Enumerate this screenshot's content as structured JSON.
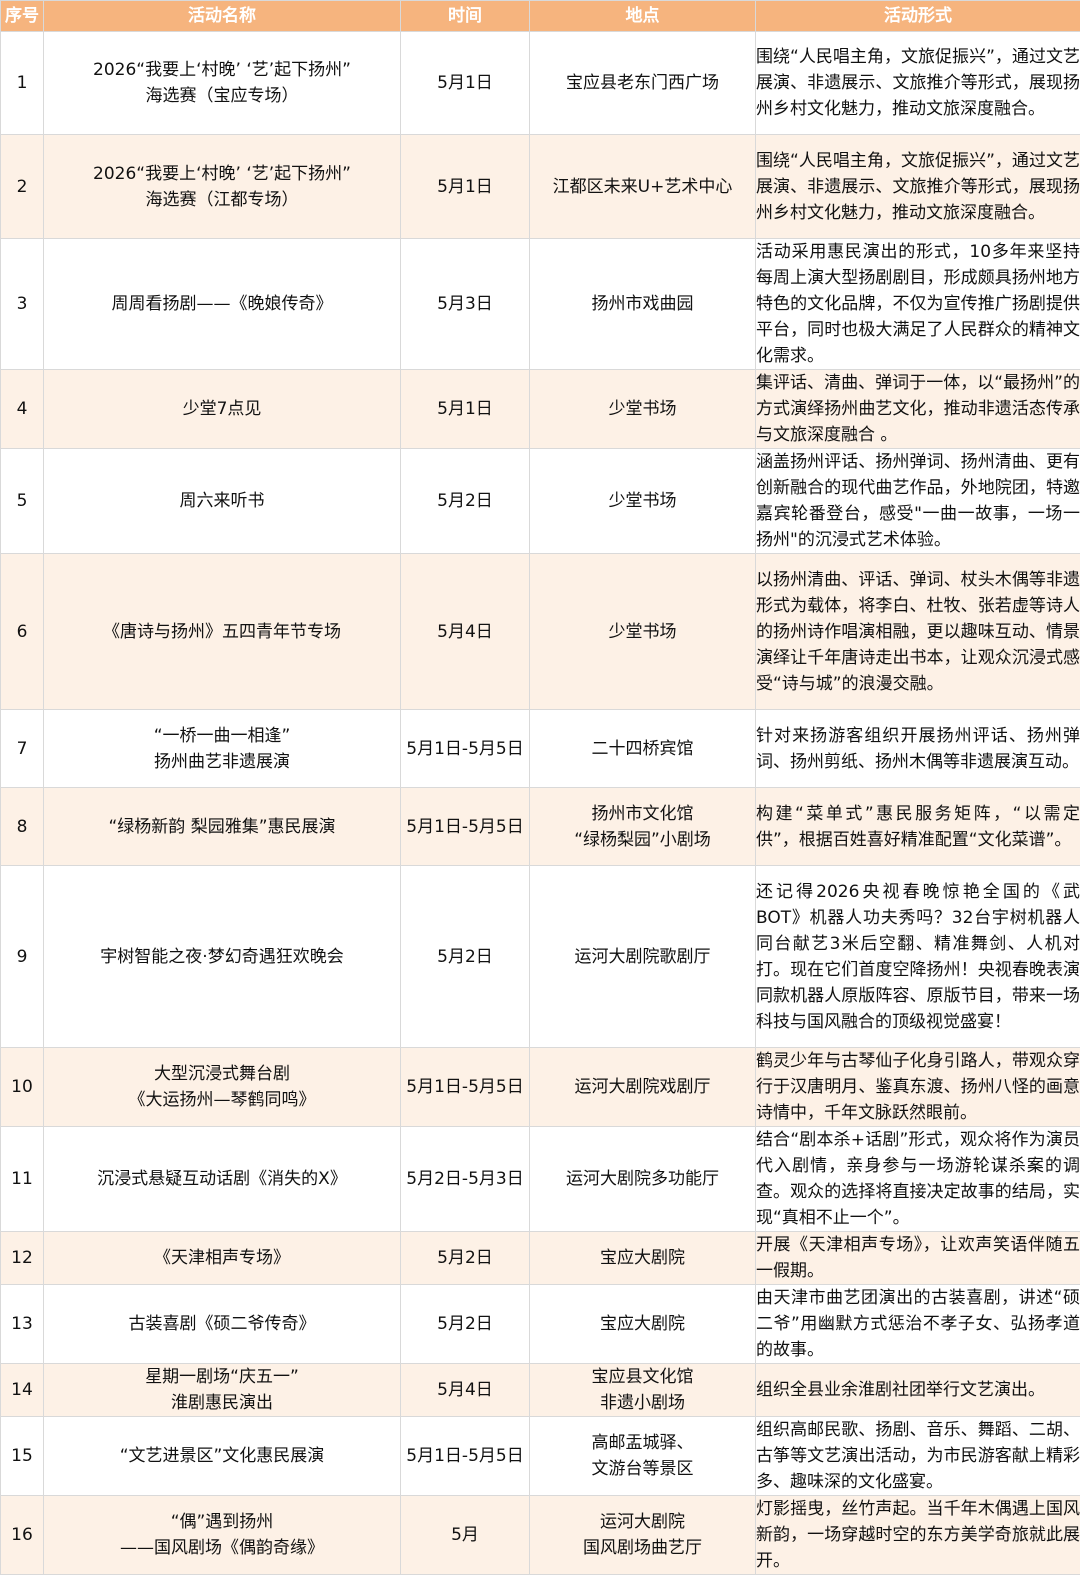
{
  "headers": [
    "序号",
    "活动名称",
    "时间",
    "地点",
    "活动形式"
  ],
  "rows": [
    {
      "no": "1",
      "name": [
        "2026“我要上‘村晚’ ‘艺’起下扬州”",
        "海选赛（宝应专场）"
      ],
      "time": [
        "5月1日"
      ],
      "place": [
        "宝应县老东门西广场"
      ],
      "form": "围绕“人民唱主角，文旅促振兴”，通过文艺展演、非遗展示、文旅推介等形式，展现扬州乡村文化魅力，推动文旅深度融合。"
    },
    {
      "no": "2",
      "name": [
        "2026“我要上‘村晚’ ‘艺’起下扬州”",
        "海选赛（江都专场）"
      ],
      "time": [
        "5月1日"
      ],
      "place": [
        "江都区未来U+艺术中心"
      ],
      "form": "围绕“人民唱主角，文旅促振兴”，通过文艺展演、非遗展示、文旅推介等形式，展现扬州乡村文化魅力，推动文旅深度融合。"
    },
    {
      "no": "3",
      "name": [
        "周周看扬剧——《晚娘传奇》"
      ],
      "time": [
        "5月3日"
      ],
      "place": [
        "扬州市戏曲园"
      ],
      "form": "活动采用惠民演出的形式，10多年来坚持每周上演大型扬剧剧目，形成颇具扬州地方特色的文化品牌，不仅为宣传推广扬剧提供平台，同时也极大满足了人民群众的精神文化需求。"
    },
    {
      "no": "4",
      "name": [
        "少堂7点见"
      ],
      "time": [
        "5月1日"
      ],
      "place": [
        "少堂书场"
      ],
      "form": "集评话、清曲、弹词于一体，以“最扬州”的方式演绎扬州曲艺文化，推动非遗活态传承与文旅深度融合 。"
    },
    {
      "no": "5",
      "name": [
        "周六来听书"
      ],
      "time": [
        "5月2日"
      ],
      "place": [
        "少堂书场"
      ],
      "form": "涵盖扬州评话、扬州弹词、扬州清曲、更有创新融合的现代曲艺作品，外地院团，特邀嘉宾轮番登台，感受\"一曲一故事，一场一扬州\"的沉浸式艺术体验。"
    },
    {
      "no": "6",
      "name": [
        "《唐诗与扬州》五四青年节专场"
      ],
      "time": [
        "5月4日"
      ],
      "place": [
        "少堂书场"
      ],
      "form": "以扬州清曲、评话、弹词、杖头木偶等非遗形式为载体，将李白、杜牧、张若虚等诗人的扬州诗作唱演相融，更以趣味互动、情景演绎让千年唐诗走出书本，让观众沉浸式感受“诗与城”的浪漫交融。"
    },
    {
      "no": "7",
      "name": [
        "“一桥一曲一相逢”",
        "扬州曲艺非遗展演"
      ],
      "time": [
        "5月1日-5月5日"
      ],
      "place": [
        "二十四桥宾馆"
      ],
      "form": "针对来扬游客组织开展扬州评话、扬州弹词、扬州剪纸、扬州木偶等非遗展演互动。"
    },
    {
      "no": "8",
      "name": [
        "“绿杨新韵 梨园雅集”惠民展演"
      ],
      "time": [
        "5月1日-5月5日"
      ],
      "place": [
        "扬州市文化馆",
        "“绿杨梨园”小剧场"
      ],
      "form": "构建“菜单式”惠民服务矩阵，“以需定供”，根据百姓喜好精准配置“文化菜谱”。"
    },
    {
      "no": "9",
      "name": [
        "宇树智能之夜·梦幻奇遇狂欢晚会"
      ],
      "time": [
        "5月2日"
      ],
      "place": [
        "运河大剧院歌剧厅"
      ],
      "form": "还记得2026央视春晚惊艳全国的《武BOT》机器人功夫秀吗？32台宇树机器人同台献艺3米后空翻、精准舞剑、人机对打。现在它们首度空降扬州！央视春晚表演同款机器人原版阵容、原版节目，带来一场科技与国风融合的顶级视觉盛宴！"
    },
    {
      "no": "10",
      "name": [
        "大型沉浸式舞台剧",
        "《大运扬州—琴鹤同鸣》"
      ],
      "time": [
        "5月1日-5月5日"
      ],
      "place": [
        "运河大剧院戏剧厅"
      ],
      "form": "鹤灵少年与古琴仙子化身引路人，带观众穿行于汉唐明月、鉴真东渡、扬州八怪的画意诗情中，千年文脉跃然眼前。"
    },
    {
      "no": "11",
      "name": [
        "沉浸式悬疑互动话剧《消失的X》"
      ],
      "time": [
        "5月2日-5月3日"
      ],
      "place": [
        "运河大剧院多功能厅"
      ],
      "form": "结合“剧本杀+话剧”形式，观众将作为演员代入剧情，亲身参与一场游轮谋杀案的调查。观众的选择将直接决定故事的结局，实现“真相不止一个”。"
    },
    {
      "no": "12",
      "name": [
        "《天津相声专场》"
      ],
      "time": [
        "5月2日"
      ],
      "place": [
        "宝应大剧院"
      ],
      "form": "开展《天津相声专场》，让欢声笑语伴随五一假期。"
    },
    {
      "no": "13",
      "name": [
        "古装喜剧《硕二爷传奇》"
      ],
      "time": [
        "5月2日"
      ],
      "place": [
        "宝应大剧院"
      ],
      "form": "由天津市曲艺团演出的古装喜剧，讲述“硕二爷”用幽默方式惩治不孝子女、弘扬孝道的故事。"
    },
    {
      "no": "14",
      "name": [
        "星期一剧场“庆五一”",
        "淮剧惠民演出"
      ],
      "time": [
        "5月4日"
      ],
      "place": [
        "宝应县文化馆",
        "非遗小剧场"
      ],
      "form": "组织全县业余淮剧社团举行文艺演出。"
    },
    {
      "no": "15",
      "name": [
        "“文艺进景区”文化惠民展演"
      ],
      "time": [
        "5月1日-5月5日"
      ],
      "place": [
        "高邮盂城驿、",
        "文游台等景区"
      ],
      "form": "组织高邮民歌、扬剧、音乐、舞蹈、二胡、古筝等文艺演出活动，为市民游客献上精彩多、趣味深的文化盛宴。"
    },
    {
      "no": "16",
      "name": [
        "“偶”遇到扬州",
        "——国风剧场《偶韵奇缘》"
      ],
      "time": [
        "5月"
      ],
      "place": [
        "运河大剧院",
        "国风剧场曲艺厅"
      ],
      "form": "灯影摇曳，丝竹声起。当千年木偶遇上国风新韵，一场穿越时空的东方美学奇旅就此展开。"
    }
  ]
}
